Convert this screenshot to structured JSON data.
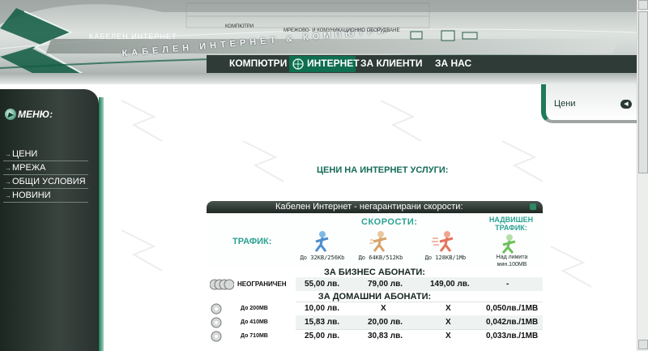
{
  "header": {
    "logo_small": "КАБЕЛЕН ИНТЕРНЕТ",
    "brand": "КАБЕЛЕН ИНТЕРНЕТ & КОМПЮТРИ",
    "tag_left": "КОМПЮТРИ",
    "tag_right": "МРЕЖОВО- И КОМУНИКАЦИОННО ОБОРУДВАНЕ",
    "nav": [
      {
        "label": "КОМПЮТРИ"
      },
      {
        "label": "ИНТЕРНЕТ"
      },
      {
        "label": "ЗА КЛИЕНТИ"
      },
      {
        "label": "ЗА НАС"
      }
    ],
    "active_nav": "ИНТЕРНЕТ"
  },
  "sidebar": {
    "title": "МЕНЮ:",
    "items": [
      {
        "label": "ЦЕНИ"
      },
      {
        "label": "МРЕЖА"
      },
      {
        "label": "ОБЩИ УСЛОВИЯ"
      },
      {
        "label": "НОВИНИ"
      }
    ]
  },
  "right_panel": {
    "label": "Цени"
  },
  "main": {
    "title": "ЦЕНИ НА ИНТЕРНЕТ УСЛУГИ:"
  },
  "pricing": {
    "header": "Кабелен Интернет - негарантирани скорости:",
    "speeds_label": "СКОРОСТИ:",
    "traffic_label": "ТРАФИК:",
    "over_label": "НАДВИШЕН ТРАФИК:",
    "speeds": [
      {
        "label": "До 32KB/256Kb"
      },
      {
        "label": "До 64KB/512Kb"
      },
      {
        "label": "До 128KB/1Mb"
      }
    ],
    "over_desc": "Над лимита мин.100МВ",
    "business_label": "ЗА БИЗНЕС АБОНАТИ:",
    "home_label": "ЗА ДОМАШНИ АБОНАТИ:",
    "business_rows": [
      {
        "traffic": "НЕОГРАНИЧЕН",
        "p1": "55,00 лв.",
        "p2": "79,00 лв.",
        "p3": "149,00 лв.",
        "over": "-"
      }
    ],
    "home_rows": [
      {
        "traffic": "До 200МВ",
        "p1": "10,00 лв.",
        "p2": "X",
        "p3": "X",
        "over": "0,050лв./1МВ"
      },
      {
        "traffic": "До 410МВ",
        "p1": "15,83 лв.",
        "p2": "20,00 лв.",
        "p3": "X",
        "over": "0,042лв./1МВ"
      },
      {
        "traffic": "До 710МВ",
        "p1": "25,00 лв.",
        "p2": "30,83 лв.",
        "p3": "X",
        "over": "0,033лв./1МВ"
      }
    ]
  },
  "colors": {
    "accent": "#1f7a58",
    "title_teal": "#156b58",
    "header_teal": "#2aa292",
    "x_red": "#d01010"
  }
}
